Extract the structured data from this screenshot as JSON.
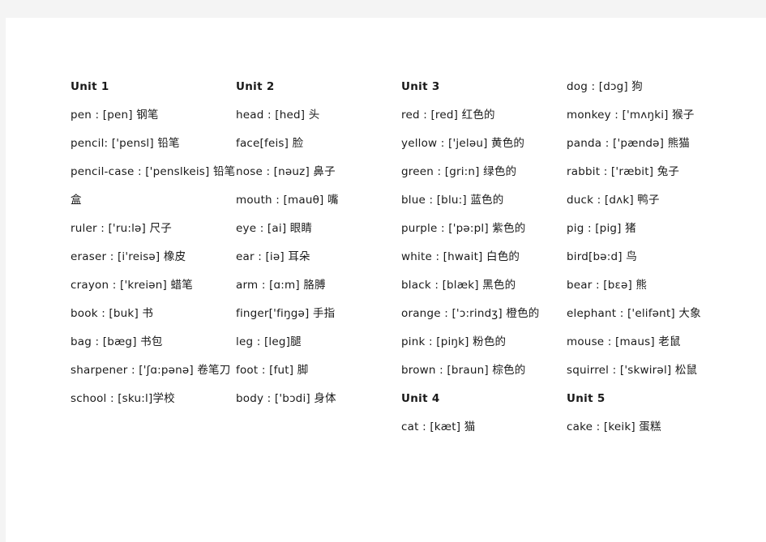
{
  "page": {
    "background_color": "#ffffff",
    "surround_color": "#f4f4f4",
    "text_color": "#1a1a1a"
  },
  "columns": [
    {
      "name": "column-1",
      "entries": [
        {
          "type": "heading",
          "text": "Unit 1"
        },
        {
          "type": "word",
          "text": "pen : [pen]  钢笔"
        },
        {
          "type": "word",
          "text": "pencil: ['pensl]  铅笔"
        },
        {
          "type": "word",
          "text": "pencil-case : ['penslkeis]  铅笔"
        },
        {
          "type": "wrap",
          "text": "盒"
        },
        {
          "type": "word",
          "text": "ruler : ['ru:lə]  尺子"
        },
        {
          "type": "word",
          "text": "eraser : [i'reisə]   橡皮"
        },
        {
          "type": "word",
          "text": "crayon : ['kreiən]  蜡笔"
        },
        {
          "type": "word",
          "text": "book : [buk]  书"
        },
        {
          "type": "word",
          "text": "bag : [bæg]  书包"
        },
        {
          "type": "word",
          "text": "sharpener : ['ʃɑ:pənə]  卷笔刀"
        },
        {
          "type": "word",
          "text": "school   : [sku:l]学校"
        }
      ]
    },
    {
      "name": "column-2",
      "entries": [
        {
          "type": "heading",
          "text": "Unit 2"
        },
        {
          "type": "word",
          "text": "head : [hed]  头"
        },
        {
          "type": "word",
          "text": "face[feis]  脸"
        },
        {
          "type": "word",
          "text": "nose : [nəuz]  鼻子"
        },
        {
          "type": "word",
          "text": "mouth : [mauθ]  嘴"
        },
        {
          "type": "word",
          "text": "eye : [ai]  眼睛"
        },
        {
          "type": "word",
          "text": "ear : [iə]  耳朵"
        },
        {
          "type": "word",
          "text": "arm : [ɑ:m]  胳膊"
        },
        {
          "type": "word",
          "text": "finger['fiŋgə]  手指"
        },
        {
          "type": "word",
          "text": "leg : [leg]腿"
        },
        {
          "type": "word",
          "text": "foot : [fut]  脚"
        },
        {
          "type": "word",
          "text": "body : ['bɔdi]  身体"
        }
      ]
    },
    {
      "name": "column-3",
      "entries": [
        {
          "type": "heading",
          "text": "Unit 3"
        },
        {
          "type": "word",
          "text": "red : [red]  红色的"
        },
        {
          "type": "word",
          "text": "yellow : ['jeləu]  黄色的"
        },
        {
          "type": "word",
          "text": "green : [gri:n]  绿色的"
        },
        {
          "type": "word",
          "text": "blue : [blu:]  蓝色的"
        },
        {
          "type": "word",
          "text": "purple : ['pə:pl]  紫色的"
        },
        {
          "type": "word",
          "text": "white : [hwait]  白色的"
        },
        {
          "type": "word",
          "text": "black : [blæk]  黑色的"
        },
        {
          "type": "word",
          "text": "orange : ['ɔ:rindʒ]  橙色的"
        },
        {
          "type": "word",
          "text": "pink : [piŋk]  粉色的"
        },
        {
          "type": "word",
          "text": "brown : [braun]  棕色的"
        },
        {
          "type": "heading",
          "text": "Unit 4"
        },
        {
          "type": "word",
          "text": "cat : [kæt]  猫"
        }
      ]
    },
    {
      "name": "column-4",
      "entries": [
        {
          "type": "word",
          "text": "dog : [dɔg]  狗"
        },
        {
          "type": "word",
          "text": "monkey : ['mʌŋki]  猴子"
        },
        {
          "type": "word",
          "text": "panda : ['pændə]  熊猫"
        },
        {
          "type": "word",
          "text": "rabbit : ['ræbit]  兔子"
        },
        {
          "type": "word",
          "text": "duck : [dʌk]  鸭子"
        },
        {
          "type": "word",
          "text": "pig : [pig]  猪"
        },
        {
          "type": "word",
          "text": "bird[bə:d]  鸟"
        },
        {
          "type": "word",
          "text": "bear : [bɛə]  熊"
        },
        {
          "type": "word",
          "text": "elephant : ['elifənt]  大象"
        },
        {
          "type": "word",
          "text": "mouse : [maus]  老鼠"
        },
        {
          "type": "word",
          "text": "squirrel : ['skwirəl]  松鼠"
        },
        {
          "type": "heading",
          "text": "Unit 5"
        },
        {
          "type": "word",
          "text": "cake : [keik]  蛋糕"
        }
      ]
    }
  ]
}
